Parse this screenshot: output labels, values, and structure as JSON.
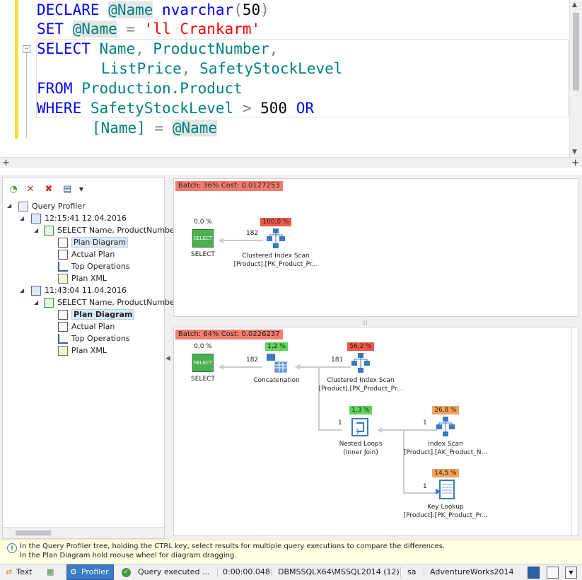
{
  "editor": {
    "line1": {
      "kw": "DECLARE",
      "var": "@Name",
      "type": "nvarchar",
      "open": "(",
      "num": "50",
      "close": ")"
    },
    "line2": {
      "kw": "SET",
      "var": "@Name",
      "eq": "=",
      "str": "'ll Crankarm'"
    },
    "line3": {
      "kw": "SELECT",
      "col1": "Name",
      "comma1": ",",
      "col2": "ProductNumber",
      "comma2": ","
    },
    "line4": {
      "col3": "ListPrice",
      "comma3": ",",
      "col4": "SafetyStockLevel"
    },
    "line5": {
      "kw": "FROM",
      "table": "Production.Product"
    },
    "line6": {
      "kw": "WHERE",
      "col": "SafetyStockLevel",
      "op": ">",
      "num": "500",
      "kw2": "OR"
    },
    "line7": {
      "col": "[Name]",
      "eq": "=",
      "var": "@Name"
    },
    "fold_symbol": "−",
    "split_symbol": "+"
  },
  "tree": {
    "toolbar": [
      "refresh-icon",
      "delete-icon",
      "delete-all-icon",
      "export-icon"
    ],
    "root_label": "Query Profiler",
    "sessions": [
      {
        "time": "12:15:41 12.04.2016",
        "query": "SELECT Name, ProductNumbe",
        "items": [
          "Plan Diagram",
          "Actual Plan",
          "Top Operations",
          "Plan XML"
        ]
      },
      {
        "time": "11:43:04 11.04.2016",
        "query": "SELECT Name, ProductNumbe",
        "items": [
          "Plan Diagram",
          "Actual Plan",
          "Top Operations",
          "Plan XML"
        ]
      }
    ]
  },
  "plan1": {
    "header": "Batch: 36% Cost: 0.0127253",
    "select": {
      "pct": "0,0 %",
      "label": "SELECT"
    },
    "scan": {
      "pct": "100,0 %",
      "label1": "Clustered Index Scan",
      "label2": "[Product].[PK_Product_Pr..."
    },
    "edge": "182"
  },
  "plan2": {
    "header": "Batch: 64% Cost: 0.0226237",
    "select": {
      "pct": "0,0 %",
      "label": "SELECT"
    },
    "concat": {
      "pct": "1,2 %",
      "label": "Concatenation"
    },
    "cis": {
      "pct": "56,2 %",
      "label1": "Clustered Index Scan",
      "label2": "[Product].[PK_Product_Pr..."
    },
    "loops": {
      "pct": "1,3 %",
      "label1": "Nested Loops",
      "label2": "(Inner Join)"
    },
    "iscan": {
      "pct": "26,8 %",
      "label1": "Index Scan",
      "label2": "[Product].[AK_Product_N..."
    },
    "lookup": {
      "pct": "14,5 %",
      "label1": "Key Lookup",
      "label2": "[Product].[PK_Product_Pr..."
    },
    "edges": {
      "e1": "182",
      "e2": "181",
      "e3": "1",
      "e4": "1",
      "e5": "1"
    }
  },
  "info": {
    "line1": "In the Query Profiler tree, holding the CTRL key, select results for multiple query executions to compare the differences.",
    "line2": "In the Plan Diagram hold mouse wheel for diagram dragging."
  },
  "status": {
    "text_tab": "Text",
    "profiler_tab": "Profiler",
    "query_status": "Query executed ...",
    "duration": "0:00:00.048",
    "server": "DBMSSQLX64\\MSSQL2014 (12)",
    "user": "sa",
    "database": "AdventureWorks2014"
  },
  "colors": {
    "keyword": "#0000ff",
    "variable": "#008080",
    "string": "#ff0000",
    "high_cost": "#f05a4a",
    "low_cost": "#5ed45a",
    "mid_cost": "#f2a35a",
    "profiler_active": "#3b7ac6"
  }
}
